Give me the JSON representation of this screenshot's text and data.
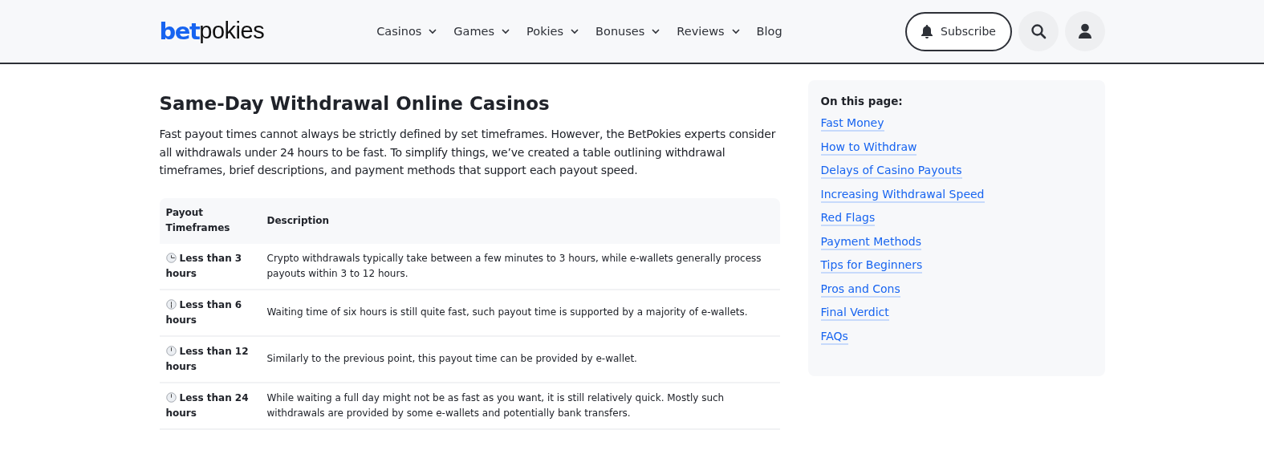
{
  "header": {
    "logo": {
      "strong": "bet",
      "light": "pokies"
    },
    "nav": [
      {
        "label": "Casinos",
        "dropdown": true
      },
      {
        "label": "Games",
        "dropdown": true
      },
      {
        "label": "Pokies",
        "dropdown": true
      },
      {
        "label": "Bonuses",
        "dropdown": true
      },
      {
        "label": "Reviews",
        "dropdown": true
      },
      {
        "label": "Blog",
        "dropdown": false
      }
    ],
    "subscribe": "Subscribe"
  },
  "article": {
    "title": "Same-Day Withdrawal Online Casinos",
    "intro": "Fast payout times cannot always be strictly defined by set timeframes. However, the BetPokies experts consider all withdrawals under 24 hours to be fast. To simplify things, we’ve created a table outlining withdrawal timeframes, brief descriptions, and payment methods that support each payout speed.",
    "table": {
      "columns": [
        "Payout Timeframes",
        "Description"
      ],
      "rows": [
        {
          "timeframe": "Less than 3 hours",
          "description": "Crypto withdrawals typically take between a few minutes to 3 hours, while e-wallets generally process payouts within 3 to 12 hours."
        },
        {
          "timeframe": "Less than 6 hours",
          "description": "Waiting time of six hours is still quite fast, such payout time is supported by a majority of e-wallets."
        },
        {
          "timeframe": "Less than 12 hours",
          "description": "Similarly to the previous point, this payout time can be provided by e-wallet."
        },
        {
          "timeframe": "Less than 24 hours",
          "description": "While waiting a full day might not be as fast as you want, it is still relatively quick. Mostly such withdrawals are provided by some e-wallets and potentially bank transfers."
        }
      ]
    }
  },
  "toc": {
    "title": "On this page:",
    "links": [
      "Fast Money",
      "How to Withdraw",
      "Delays of Casino Payouts",
      "Increasing Withdrawal Speed",
      "Red Flags",
      "Payment Methods",
      "Tips for Beginners",
      "Pros and Cons",
      "Final Verdict",
      "FAQs"
    ]
  }
}
